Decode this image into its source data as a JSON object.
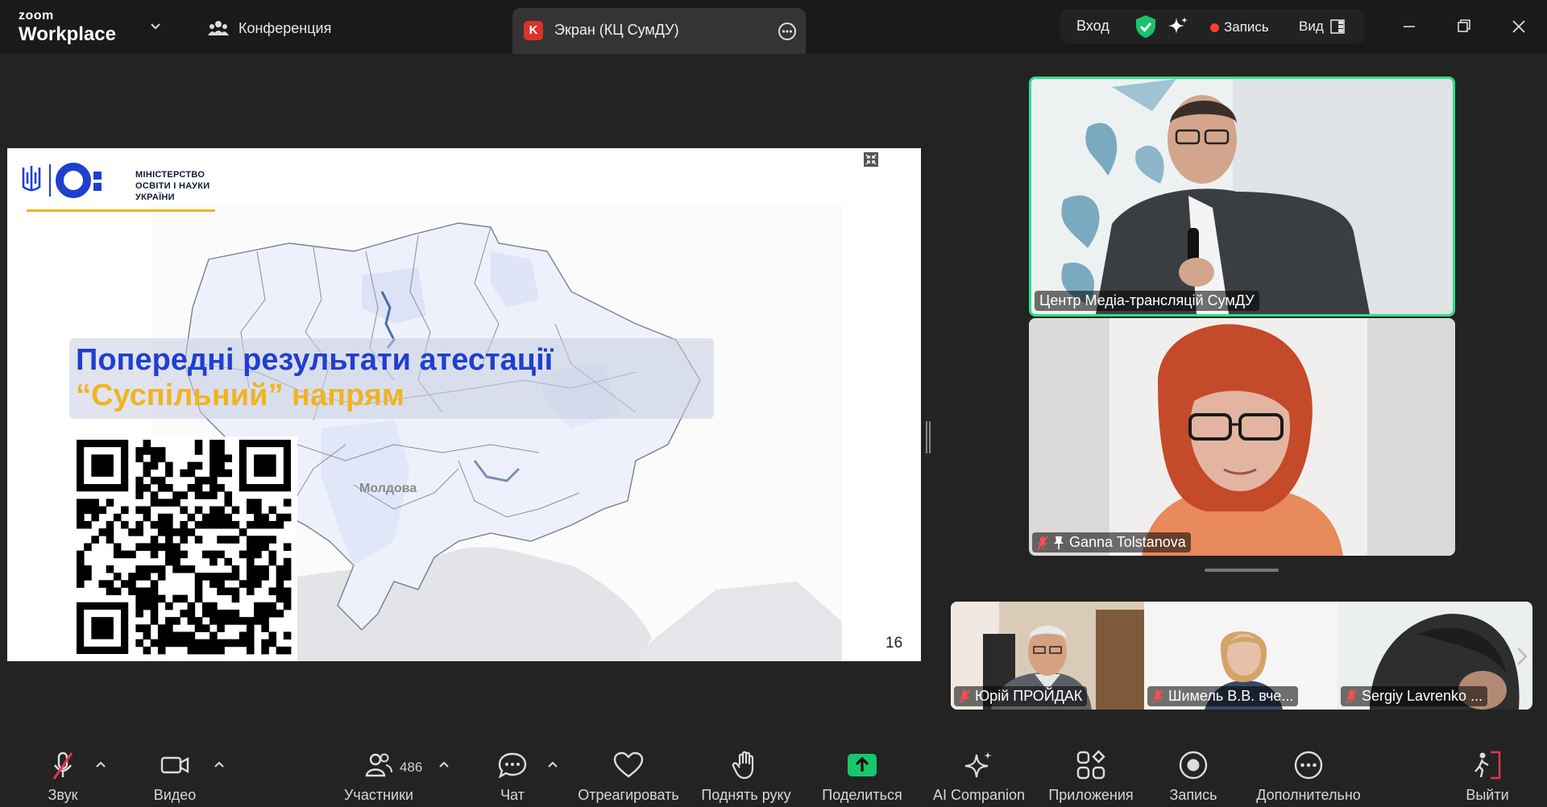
{
  "app": {
    "brand_top": "zoom",
    "brand_bottom": "Workplace",
    "tab_conference": "Конференция",
    "tab_screen_badge": "K",
    "tab_screen_title": "Экран (КЦ СумДУ)",
    "login_label": "Вход",
    "record_label": "Запись",
    "view_label": "Вид"
  },
  "slide": {
    "ministry_lines": [
      "МІНІСТЕРСТВО",
      "ОСВІТИ І НАУКИ",
      "УКРАЇНИ"
    ],
    "title_line1": "Попередні результати атестації",
    "title_line2": "“Суспільний” напрям",
    "map_label": "Молдова",
    "page_number": "16"
  },
  "participants": {
    "main_speaker": "Центр Медіа-трансляцій СумДУ",
    "second": "Ganna Tolstanova",
    "strip": [
      "Юрій ПРОЙДАК",
      "Шимель В.В. вче...",
      "Sergiy Lavrenko ..."
    ]
  },
  "toolbar": {
    "audio": "Звук",
    "video": "Видео",
    "participants": "Участники",
    "participants_count": "486",
    "chat": "Чат",
    "react": "Отреагировать",
    "raise_hand": "Поднять руку",
    "share": "Поделиться",
    "ai": "AI Companion",
    "apps": "Приложения",
    "record": "Запись",
    "more": "Дополнительно",
    "leave": "Выйти"
  },
  "colors": {
    "accent_green": "#2fe08d",
    "share_green": "#18c66e",
    "leave_red": "#e8344a",
    "title_blue": "#1f3fcf",
    "title_yellow": "#f0b322"
  }
}
